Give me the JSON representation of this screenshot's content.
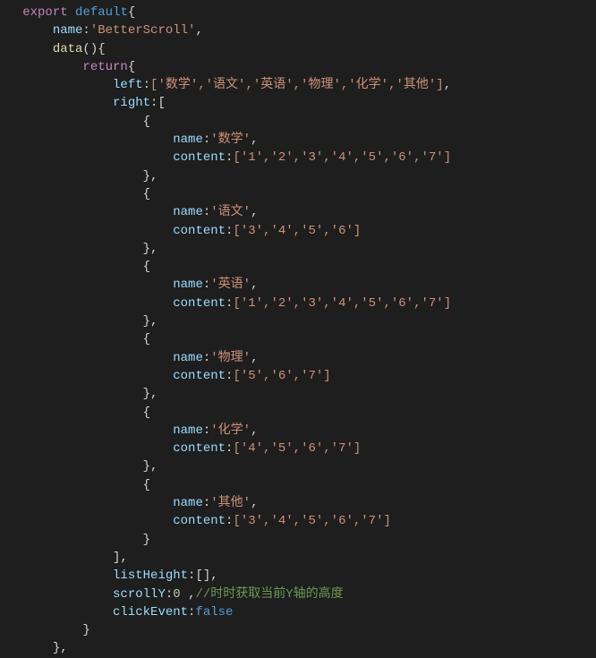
{
  "code": {
    "export": "export",
    "default": "default",
    "return": "return",
    "false": "false",
    "nameProp": "name",
    "dataFn": "data",
    "leftProp": "left",
    "rightProp": "right",
    "contentProp": "content",
    "listHeightProp": "listHeight",
    "scrollYProp": "scrollY",
    "clickEventProp": "clickEvent",
    "componentName": "'BetterScroll'",
    "leftArr": "['数学','语文','英语','物理','化学','其他']",
    "item0name": "'数学'",
    "item0content": "['1','2','3','4','5','6','7']",
    "item1name": "'语文'",
    "item1content": "['3','4','5','6']",
    "item2name": "'英语'",
    "item2content": "['1','2','3','4','5','6','7']",
    "item3name": "'物理'",
    "item3content": "['5','6','7']",
    "item4name": "'化学'",
    "item4content": "['4','5','6','7']",
    "item5name": "'其他'",
    "item5content": "['3','4','5','6','7']",
    "listHeightVal": "[]",
    "scrollYVal": "0",
    "scrollYComment": "//时时获取当前Y轴的高度"
  }
}
